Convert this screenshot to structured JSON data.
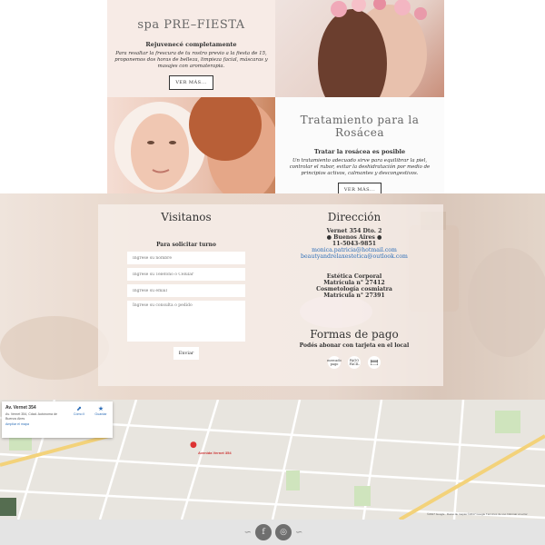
{
  "services": [
    {
      "title": "spa PRE–FIESTA",
      "subtitle": "Rejuvenecé completamente",
      "description": "Para resaltar la frescura de tu rostro previo a la fiesta de 15, proponemos dos horas de belleza, limpieza facial, máscaras y masajes con aromaterapia.",
      "button": "VER MÁS..."
    },
    {
      "title": "Tratamiento para la Rosácea",
      "subtitle": "Tratar la rosácea es posible",
      "description": "Un tratamiento adecuado sirve para equilibrar la piel, controlar el rubor, evitar la deshidratación por medio de principios activos, calmantes y descongestivos.",
      "button": "VER MÁS..."
    }
  ],
  "contact": {
    "form_title": "Visitanos",
    "form_label": "Para solicitar turno",
    "name_placeholder": "Ingrese su nombre",
    "phone_placeholder": "Ingrese su Teléfono o Celular",
    "email_placeholder": "Ingrese su email",
    "message_placeholder": "Ingrese su consulta o pedido",
    "send_button": "Enviar",
    "address_title": "Dirección",
    "address_lines": [
      "Vernet 354 Dto. 2",
      "● Buenos Aires ●",
      "11-5043-9851"
    ],
    "emails": [
      "monica.patricia@hotmail.com",
      "beautyandrelaxestetica@outlook.com"
    ],
    "business_lines": [
      "Estética Corporal",
      "Matrícula n° 27412",
      "Cosmetología cosmiatra",
      "Matrícula n° 27391"
    ],
    "pay_title": "Formas de pago",
    "pay_note": "Podés abonar con tarjeta en el local",
    "pay_icons": [
      "mercado pago",
      "PAGO FÁCIL",
      "card"
    ]
  },
  "map": {
    "card_title": "Av. Vernet 354",
    "card_address": "Av. Vernet 354, Cdad. Autónoma de Buenos Aires",
    "card_link": "Ampliar el mapa",
    "card_action_1": "Cómo ll",
    "card_action_2": "Guardar",
    "pin_label": "Avenida Vernet 354",
    "footer_text": "©2017 Google · Datos de mapas ©2017 Google   Términos de uso   Informar un error"
  },
  "colors": {
    "accent_link": "#2f6fb8",
    "pin": "#d33333",
    "footer_bg": "#e4e4e4",
    "social_bg": "#6f6f6f"
  },
  "footer": {
    "social_icons": [
      "facebook-icon",
      "instagram-icon"
    ],
    "facebook_glyph": "f",
    "instagram_glyph": "◎"
  }
}
